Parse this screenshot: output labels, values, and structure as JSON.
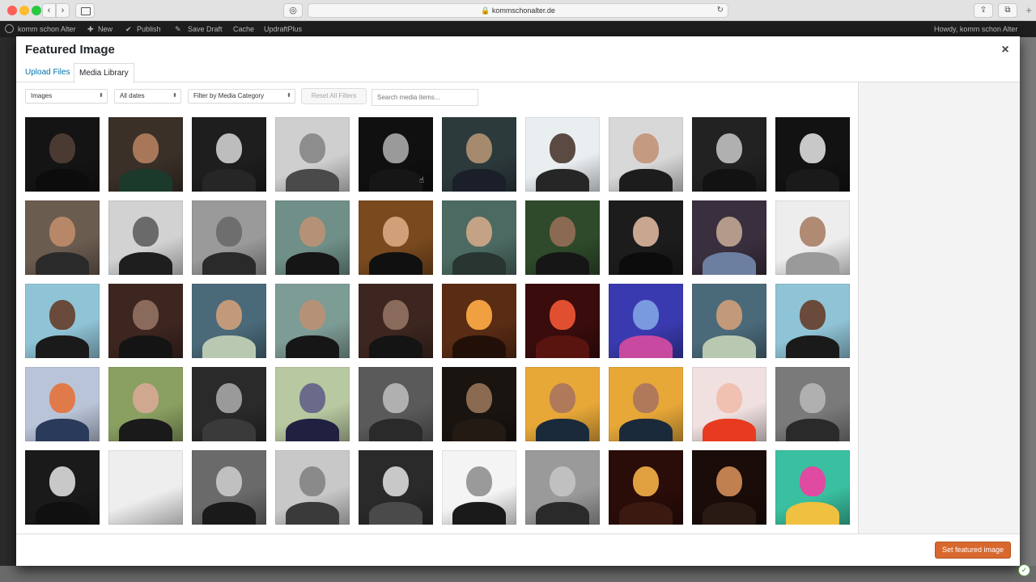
{
  "browser": {
    "address": "kommschonalter.de",
    "lock_glyph": "🔒",
    "back_glyph": "‹",
    "forward_glyph": "›",
    "reload_glyph": "↻",
    "share_glyph": "⇪",
    "tabs_glyph": "⧉",
    "newtab_glyph": "+"
  },
  "adminbar": {
    "site": "komm schon Alter",
    "new": "New",
    "publish": "Publish",
    "save_draft": "Save Draft",
    "cache": "Cache",
    "updraft": "UpdraftPlus",
    "howdy": "Howdy, komm schon Alter"
  },
  "modal": {
    "title": "Featured Image",
    "close_glyph": "×",
    "tabs": [
      {
        "label": "Upload Files"
      },
      {
        "label": "Media Library"
      }
    ],
    "filters": {
      "type": "Images",
      "date": "All dates",
      "category": "Filter by Media Category",
      "caret": "⬍",
      "reset": "Reset All Filters",
      "search_placeholder": "Search media items..."
    },
    "primary_button": "Set featured image"
  },
  "media_items": [
    {
      "bg": "#141414",
      "skin": "#4a3a32",
      "cloth": "#0c0c0c"
    },
    {
      "bg": "#3a3028",
      "skin": "#a8775a",
      "cloth": "#1b3a2c"
    },
    {
      "bg": "#1e1e1e",
      "skin": "#bdbdbd",
      "cloth": "#262626"
    },
    {
      "bg": "#cfcfcf",
      "skin": "#8d8d8d",
      "cloth": "#4a4a4a"
    },
    {
      "bg": "#101010",
      "skin": "#9a9a9a",
      "cloth": "#161616"
    },
    {
      "bg": "#2c3a3c",
      "skin": "#a58a6e",
      "cloth": "#1a1f2a"
    },
    {
      "bg": "#e9eef0",
      "skin": "#5a4a42",
      "cloth": "#262626"
    },
    {
      "bg": "#d8d8d8",
      "skin": "#c49a80",
      "cloth": "#1c1c1c"
    },
    {
      "bg": "#222222",
      "skin": "#b0b0b0",
      "cloth": "#121212"
    },
    {
      "bg": "#121212",
      "skin": "#c8c8c8",
      "cloth": "#1a1a1a"
    },
    {
      "bg": "#6b5c50",
      "skin": "#b88768",
      "cloth": "#2a2a2a"
    },
    {
      "bg": "#d2d2d2",
      "skin": "#6a6a6a",
      "cloth": "#1e1e1e"
    },
    {
      "bg": "#9a9a9a",
      "skin": "#6e6e6e",
      "cloth": "#2a2a2a"
    },
    {
      "bg": "#6f8f88",
      "skin": "#b59277",
      "cloth": "#151515"
    },
    {
      "bg": "#7a4a1e",
      "skin": "#d0a078",
      "cloth": "#101010"
    },
    {
      "bg": "#4c6a62",
      "skin": "#c3a286",
      "cloth": "#283530"
    },
    {
      "bg": "#2e4a2a",
      "skin": "#8a6a50",
      "cloth": "#161616"
    },
    {
      "bg": "#1c1c1c",
      "skin": "#c8a690",
      "cloth": "#0c0c0c"
    },
    {
      "bg": "#3a2f3e",
      "skin": "#b39a8a",
      "cloth": "#6d7fa0"
    },
    {
      "bg": "#ededed",
      "skin": "#b08a72",
      "cloth": "#9a9a9a"
    },
    {
      "bg": "#8fc3d6",
      "skin": "#6a4a3a",
      "cloth": "#1a1a1a"
    },
    {
      "bg": "#3e2620",
      "skin": "#8a6a5a",
      "cloth": "#141414"
    },
    {
      "bg": "#4a6a7a",
      "skin": "#c29a7a",
      "cloth": "#b9c8b0"
    },
    {
      "bg": "#7e9c96",
      "skin": "#b59277",
      "cloth": "#161616"
    },
    {
      "bg": "#3e2620",
      "skin": "#8a6a5a",
      "cloth": "#141414"
    },
    {
      "bg": "#5a2c14",
      "skin": "#f0a040",
      "cloth": "#221008"
    },
    {
      "bg": "#3a0c0c",
      "skin": "#e05030",
      "cloth": "#5a1410"
    },
    {
      "bg": "#3a3ab0",
      "skin": "#7a9ae0",
      "cloth": "#c84aa0"
    },
    {
      "bg": "#4a6a7a",
      "skin": "#c29a7a",
      "cloth": "#b9c8b0"
    },
    {
      "bg": "#8fc3d6",
      "skin": "#6a4a3a",
      "cloth": "#1a1a1a"
    },
    {
      "bg": "#b9c4d8",
      "skin": "#e07a4a",
      "cloth": "#2a3a5a"
    },
    {
      "bg": "#8aa060",
      "skin": "#d0a890",
      "cloth": "#1a1a1a"
    },
    {
      "bg": "#2a2a2a",
      "skin": "#9a9a9a",
      "cloth": "#3a3a3a"
    },
    {
      "bg": "#b8c8a0",
      "skin": "#6a6a8a",
      "cloth": "#202040"
    },
    {
      "bg": "#5a5a5a",
      "skin": "#b0b0b0",
      "cloth": "#2a2a2a"
    },
    {
      "bg": "#1a1410",
      "skin": "#8a6a50",
      "cloth": "#241a14"
    },
    {
      "bg": "#e8a838",
      "skin": "#b07a5a",
      "cloth": "#1a2a3a"
    },
    {
      "bg": "#e8a838",
      "skin": "#b07a5a",
      "cloth": "#1a2a3a"
    },
    {
      "bg": "#f0e0e0",
      "skin": "#f0c0b0",
      "cloth": "#e83a20"
    },
    {
      "bg": "#7a7a7a",
      "skin": "#b0b0b0",
      "cloth": "#2a2a2a"
    },
    {
      "bg": "#1a1a1a",
      "skin": "#c8c8c8",
      "cloth": "#101010"
    },
    {
      "bg": "#eeeeee",
      "skin": "#eeeeee",
      "cloth": "#eeeeee",
      "blank": true
    },
    {
      "bg": "#6a6a6a",
      "skin": "#c0c0c0",
      "cloth": "#1a1a1a"
    },
    {
      "bg": "#c8c8c8",
      "skin": "#8a8a8a",
      "cloth": "#3a3a3a"
    },
    {
      "bg": "#2a2a2a",
      "skin": "#c8c8c8",
      "cloth": "#4a4a4a"
    },
    {
      "bg": "#f4f4f4",
      "skin": "#9a9a9a",
      "cloth": "#1a1a1a"
    },
    {
      "bg": "#9a9a9a",
      "skin": "#c0c0c0",
      "cloth": "#2a2a2a"
    },
    {
      "bg": "#2a0c08",
      "skin": "#e0a040",
      "cloth": "#3a1a10"
    },
    {
      "bg": "#1a0c08",
      "skin": "#c08050",
      "cloth": "#2a1a14"
    },
    {
      "bg": "#3ac0a0",
      "skin": "#e04aa0",
      "cloth": "#f0c040"
    }
  ]
}
